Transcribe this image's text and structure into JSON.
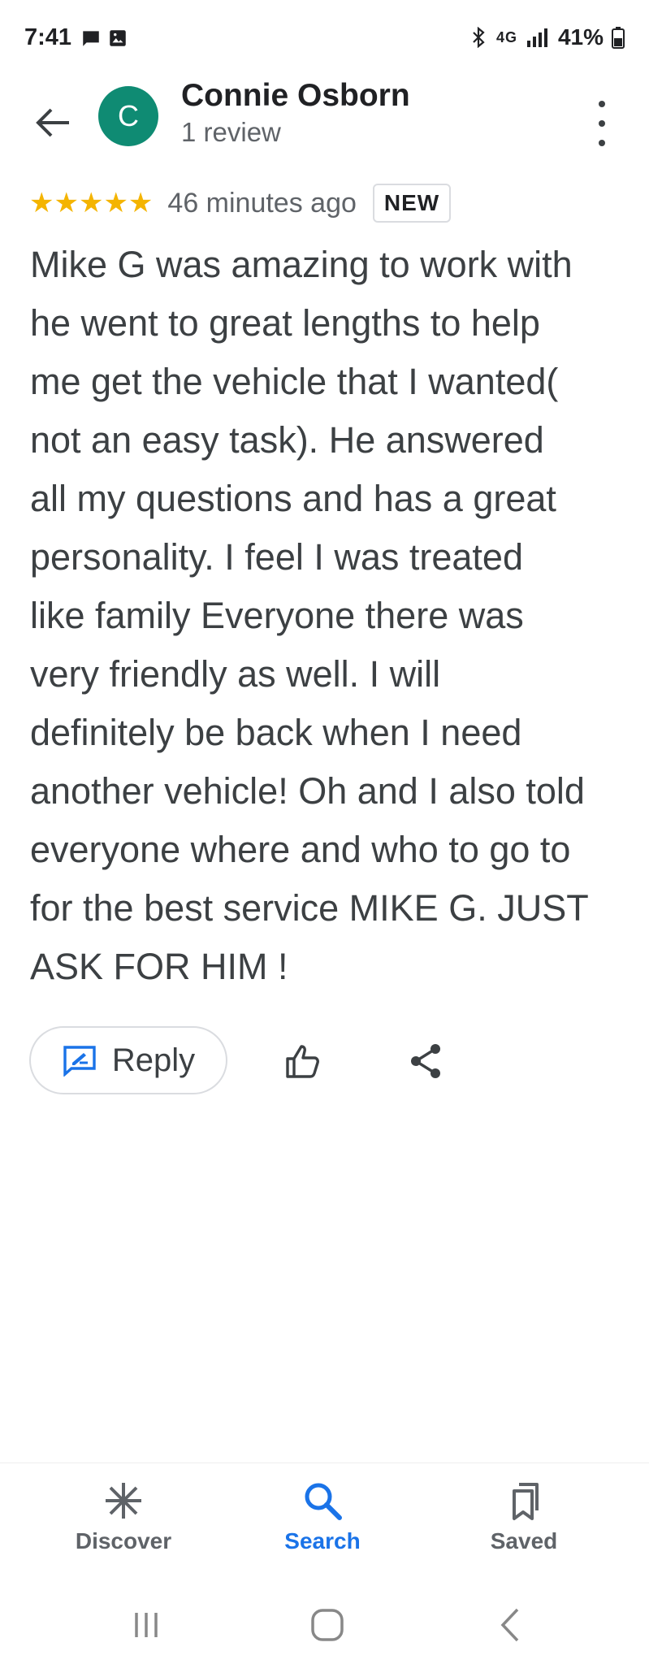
{
  "status_bar": {
    "time": "7:41",
    "network": "4G",
    "battery": "41%"
  },
  "header": {
    "avatar_letter": "C",
    "reviewer_name": "Connie Osborn",
    "review_count": "1 review"
  },
  "review": {
    "rating": 5,
    "stars": "★★★★★",
    "time_ago": "46 minutes ago",
    "badge": "NEW",
    "text": "Mike G was amazing to work with\nhe went to great lengths to help\nme get the vehicle that I wanted(\nnot an easy task). He answered\nall my questions and has a great\npersonality. I feel I was treated\nlike family Everyone there was\nvery friendly as well. I will\ndefinitely be back when I need\nanother vehicle! Oh and I also told\neveryone where and who to go to\nfor the best service MIKE G. JUST\nASK FOR HIM !"
  },
  "actions": {
    "reply_label": "Reply"
  },
  "bottom_nav": {
    "items": [
      {
        "label": "Discover",
        "icon": "asterisk-icon"
      },
      {
        "label": "Search",
        "icon": "search-icon",
        "active": true
      },
      {
        "label": "Saved",
        "icon": "bookmarks-icon"
      }
    ]
  },
  "colors": {
    "avatar_bg": "#0f8b73",
    "star": "#f4b400",
    "accent": "#1a73e8"
  }
}
